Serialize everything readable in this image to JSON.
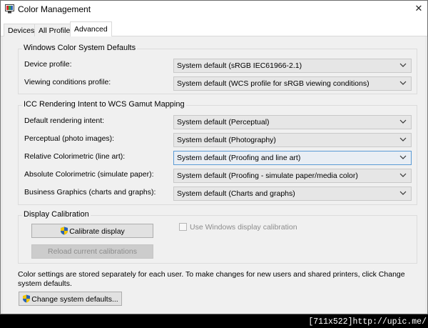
{
  "window": {
    "title": "Color Management",
    "close_glyph": "✕"
  },
  "tabs": [
    {
      "label": "Devices",
      "active": false
    },
    {
      "label": "All Profiles",
      "active": false
    },
    {
      "label": "Advanced",
      "active": true
    }
  ],
  "wcs_defaults": {
    "title": "Windows Color System Defaults",
    "rows": [
      {
        "label": "Device profile:",
        "value": "System default (sRGB IEC61966-2.1)"
      },
      {
        "label": "Viewing conditions profile:",
        "value": "System default (WCS profile for sRGB viewing conditions)"
      }
    ]
  },
  "icc_mapping": {
    "title": "ICC Rendering Intent to WCS Gamut Mapping",
    "rows": [
      {
        "label": "Default rendering intent:",
        "value": "System default (Perceptual)"
      },
      {
        "label": "Perceptual (photo images):",
        "value": "System default (Photography)"
      },
      {
        "label": "Relative Colorimetric (line art):",
        "value": "System default (Proofing and line art)"
      },
      {
        "label": "Absolute Colorimetric (simulate paper):",
        "value": "System default (Proofing - simulate paper/media color)"
      },
      {
        "label": "Business Graphics (charts and graphs):",
        "value": "System default (Charts and graphs)"
      }
    ]
  },
  "calibration": {
    "title": "Display Calibration",
    "calibrate_label": "Calibrate display",
    "reload_label": "Reload current calibrations",
    "checkbox_label": "Use Windows display calibration",
    "checkbox_checked": false
  },
  "footer": {
    "note": "Color settings are stored separately for each user. To make changes for new users and shared printers, click Change system defaults.",
    "change_defaults_label": "Change system defaults..."
  },
  "watermark": "[711x522]http://upic.me/",
  "colors": {
    "panel_bg": "#f0f0f0",
    "select_bg": "#e6e6e6",
    "focus_border": "#5b9bd5",
    "shield_blue": "#2b63b5",
    "shield_yellow": "#f2c500"
  },
  "icons": [
    "color-management-app-icon",
    "close-icon",
    "chevron-down-icon",
    "uac-shield-icon"
  ]
}
